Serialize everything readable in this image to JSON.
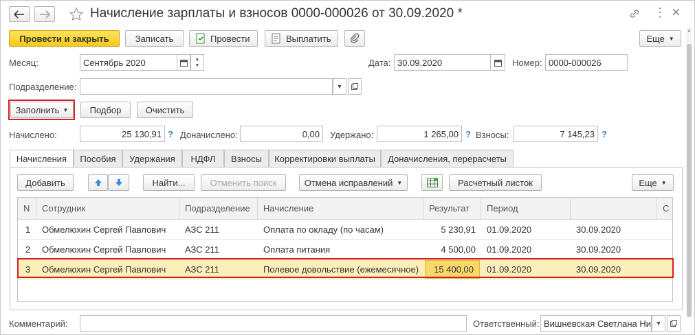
{
  "window": {
    "title": "Начисление зарплаты и взносов 0000-000026 от 30.09.2020 *",
    "more_icon": "⋮",
    "close_icon": "×"
  },
  "toolbar": {
    "post_close": "Провести и закрыть",
    "save": "Записать",
    "post": "Провести",
    "pay": "Выплатить",
    "more": "Еще"
  },
  "fields": {
    "month_label": "Месяц:",
    "month_value": "Сентябрь 2020",
    "date_label": "Дата:",
    "date_value": "30.09.2020",
    "number_label": "Номер:",
    "number_value": "0000-000026",
    "division_label": "Подразделение:",
    "division_value": ""
  },
  "actions": {
    "fill": "Заполнить",
    "select": "Подбор",
    "clear": "Очистить"
  },
  "totals": {
    "accrued_label": "Начислено:",
    "accrued_value": "25 130,91",
    "extra_label": "Доначислено:",
    "extra_value": "0,00",
    "withheld_label": "Удержано:",
    "withheld_value": "1 265,00",
    "contrib_label": "Взносы:",
    "contrib_value": "7 145,23",
    "help": "?"
  },
  "tabs": [
    "Начисления",
    "Пособия",
    "Удержания",
    "НДФЛ",
    "Взносы",
    "Корректировки выплаты",
    "Доначисления, перерасчеты"
  ],
  "table_toolbar": {
    "add": "Добавить",
    "find": "Найти...",
    "cancel_search": "Отменить поиск",
    "cancel_fix": "Отмена исправлений",
    "payslip": "Расчетный листок",
    "more": "Еще"
  },
  "table": {
    "columns": [
      "N",
      "Сотрудник",
      "Подразделение",
      "Начисление",
      "Результат",
      "Период",
      "",
      "С"
    ],
    "rows": [
      [
        "1",
        "Обмелюхин Сергей Павлович",
        "АЗС 211",
        "Оплата по окладу (по часам)",
        "5 230,91",
        "01.09.2020",
        "30.09.2020"
      ],
      [
        "2",
        "Обмелюхин Сергей Павлович",
        "АЗС 211",
        "Оплата питания",
        "4 500,00",
        "01.09.2020",
        "30.09.2020"
      ],
      [
        "3",
        "Обмелюхин Сергей Павлович",
        "АЗС 211",
        "Полевое довольствие (ежемесячное)",
        "15 400,00",
        "01.09.2020",
        "30.09.2020"
      ]
    ]
  },
  "footer": {
    "comment_label": "Комментарий:",
    "comment_value": "",
    "responsible_label": "Ответственный:",
    "responsible_value": "Вишневская Светлана Ни"
  },
  "colors": {
    "accent_yellow": "#f5c91a",
    "highlight_red": "#d11f26",
    "selected_row": "#fbeeb9"
  }
}
